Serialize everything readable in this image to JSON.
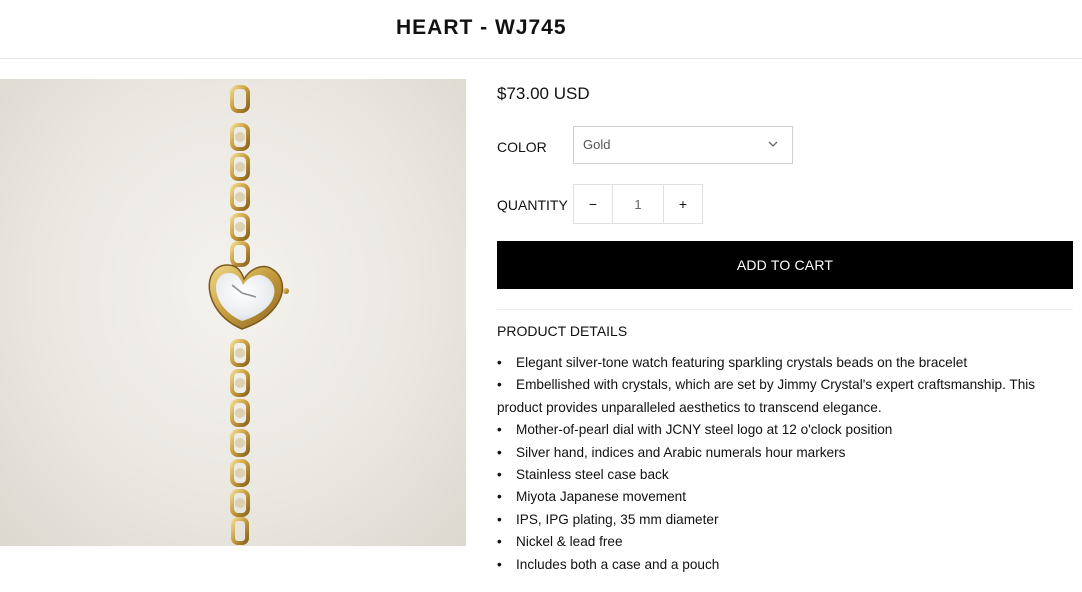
{
  "header": {
    "title": "HEART - WJ745"
  },
  "product": {
    "price": "$73.00 USD",
    "color": {
      "label": "COLOR",
      "selected": "Gold"
    },
    "quantity": {
      "label": "QUANTITY",
      "value": "1",
      "minus": "−",
      "plus": "+"
    },
    "add_to_cart": "ADD TO CART"
  },
  "details": {
    "heading": "PRODUCT DETAILS",
    "items": [
      "Elegant silver-tone watch featuring sparkling crystals beads on the bracelet",
      "Embellished with crystals, which are set by Jimmy Crystal's expert craftsmanship. This product provides unparalleled aesthetics to transcend elegance.",
      "Mother-of-pearl dial with JCNY steel logo at 12 o'clock position",
      "Silver hand, indices and Arabic numerals hour markers",
      "Stainless steel case back",
      "Miyota Japanese movement",
      "IPS, IPG plating, 35 mm diameter",
      "Nickel & lead free",
      "Includes both a case and a pouch"
    ]
  },
  "colors": {
    "button_bg": "#000000",
    "gold": "#c9a24a",
    "border": "#cfcfcf"
  },
  "icons": {
    "select": "chevron-down-icon"
  }
}
